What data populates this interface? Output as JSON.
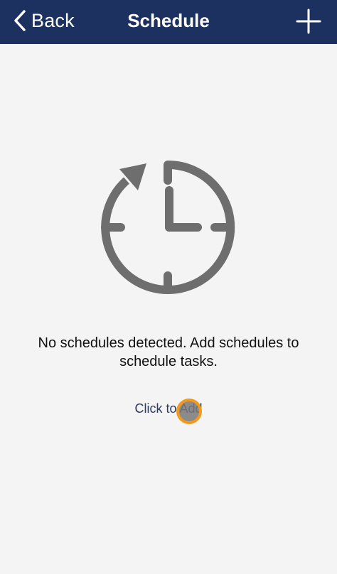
{
  "navbar": {
    "back_label": "Back",
    "title": "Schedule",
    "add_icon": "plus-icon",
    "back_icon": "chevron-left-icon",
    "background": "#1d3160"
  },
  "empty_state": {
    "icon": "clock-refresh-icon",
    "message": "No schedules detected. Add schedules to schedule tasks.",
    "action_label": "Click to Add"
  },
  "colors": {
    "icon_gray": "#6e6e6e",
    "touch_ring": "#f39a1e",
    "background": "#f4f4f4"
  }
}
